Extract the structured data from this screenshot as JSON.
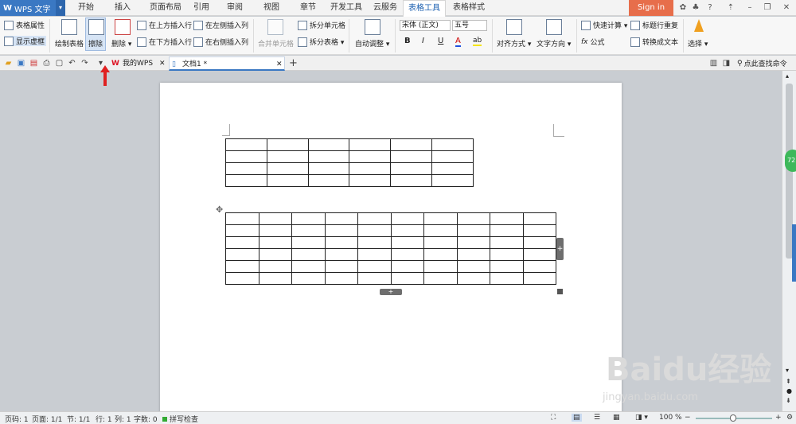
{
  "app": {
    "name": "WPS 文字",
    "logo": "W"
  },
  "tabs": [
    "开始",
    "插入",
    "页面布局",
    "引用",
    "审阅",
    "视图",
    "章节",
    "开发工具",
    "云服务",
    "表格工具",
    "表格样式"
  ],
  "active_tab": "表格工具",
  "signin": "Sign in",
  "ribbon": {
    "table_props": "表格属性",
    "show_gridlines": "显示虚框",
    "draw_table": "绘制表格",
    "erase": "擦除",
    "delete": "删除 ▾",
    "insert_above": "在上方插入行",
    "insert_below": "在下方插入行",
    "insert_left": "在左侧插入列",
    "insert_right": "在右侧插入列",
    "merge_cells": "合并单元格",
    "split_cells": "拆分单元格",
    "split_table": "拆分表格 ▾",
    "auto_fit": "自动调整 ▾",
    "font": "宋体 (正文)",
    "size": "五号",
    "bold": "B",
    "italic": "I",
    "underline": "U",
    "font_color": "A",
    "highlight": "ab",
    "align": "对齐方式 ▾",
    "text_dir": "文字方向 ▾",
    "quick_calc": "快速计算 ▾",
    "formula": "公式",
    "header_repeat": "标题行重复",
    "to_text": "转换成文本",
    "select": "选择 ▾"
  },
  "doc_tabs": {
    "wps": "我的WPS",
    "doc": "文档1 *"
  },
  "search_cmd": "点此查找命令",
  "side_badge": "72",
  "status": {
    "page": "页码: 1",
    "pages": "页面: 1/1",
    "section": "节: 1/1",
    "row": "行: 1",
    "col": "列: 1",
    "words": "字数: 0",
    "spell": "拼写检查",
    "zoom": "100 %"
  },
  "watermark": {
    "brand": "Baidu经验",
    "url": "jingyan.baidu.com"
  },
  "table1": {
    "rows": 4,
    "cols": 6
  },
  "table2": {
    "rows": 6,
    "cols": 10
  },
  "colors": {
    "accent": "#3a78c3",
    "signin": "#e76e4b",
    "arrow": "#e02020"
  }
}
